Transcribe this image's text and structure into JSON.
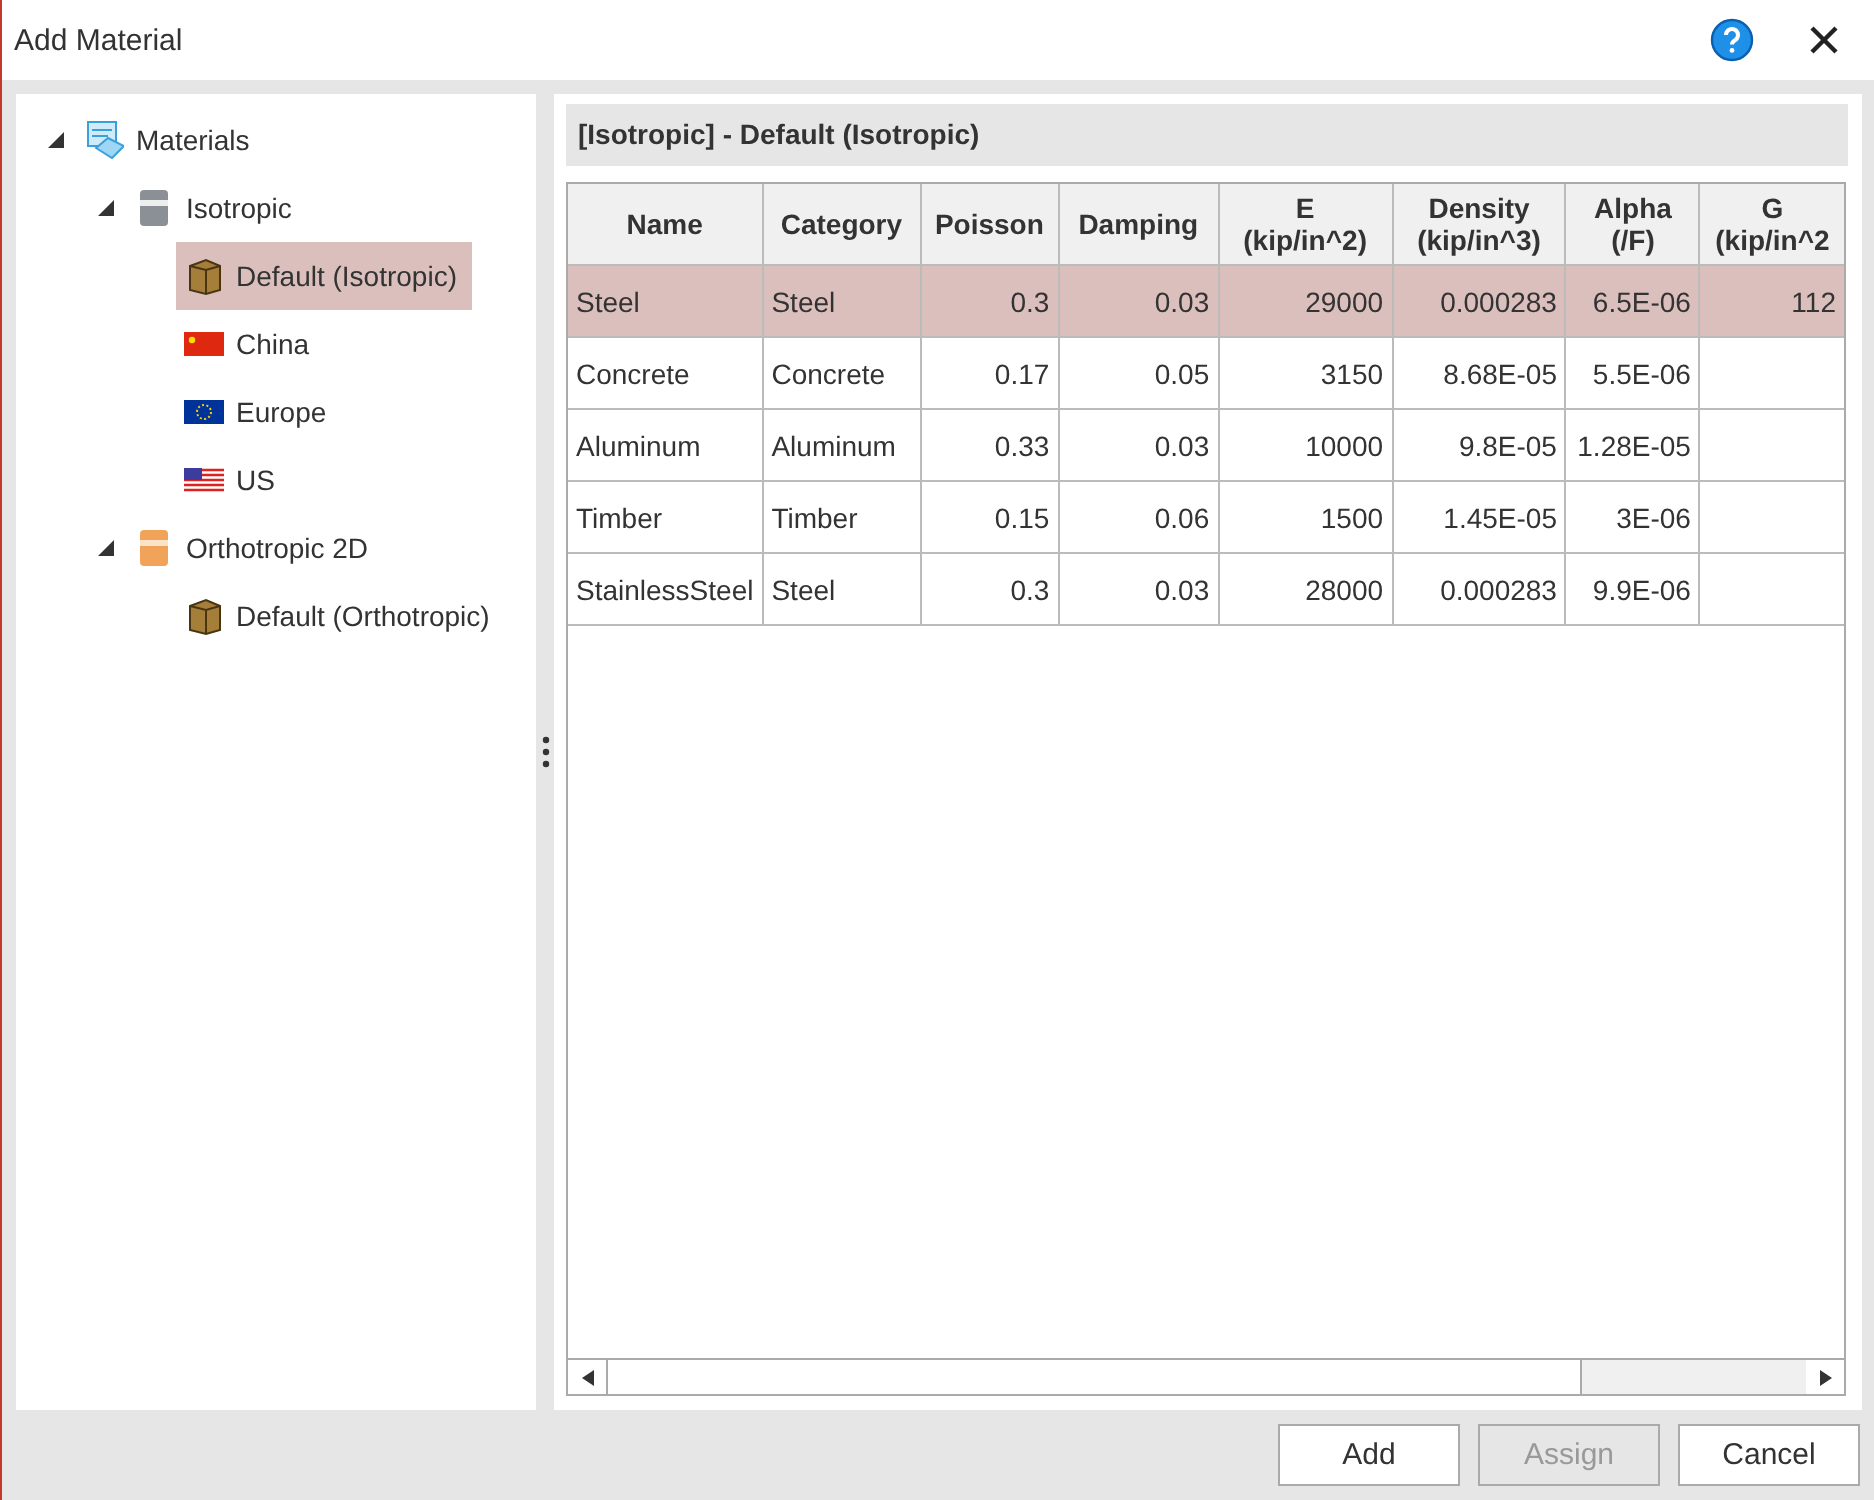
{
  "window": {
    "title": "Add Material"
  },
  "tree": [
    {
      "label": "Materials",
      "kind": "root",
      "expanded": true,
      "selected": false,
      "children": [
        {
          "label": "Isotropic",
          "kind": "group",
          "expanded": true,
          "selected": false,
          "children": [
            {
              "label": "Default (Isotropic)",
              "kind": "material",
              "selected": true
            },
            {
              "label": "China",
              "kind": "flag",
              "selected": false
            },
            {
              "label": "Europe",
              "kind": "flag",
              "selected": false
            },
            {
              "label": "US",
              "kind": "flag",
              "selected": false
            }
          ]
        },
        {
          "label": "Orthotropic 2D",
          "kind": "group",
          "expanded": true,
          "selected": false,
          "children": [
            {
              "label": "Default (Orthotropic)",
              "kind": "material",
              "selected": false
            }
          ]
        }
      ]
    }
  ],
  "panel_title": "[Isotropic] - Default (Isotropic)",
  "table": {
    "columns": [
      "Name",
      "Category",
      "Poisson",
      "Damping",
      "E\n(kip/in^2)",
      "Density\n(kip/in^3)",
      "Alpha\n(/F)",
      "G\n(kip/in^2"
    ],
    "rows": [
      {
        "selected": true,
        "cells": [
          "Steel",
          "Steel",
          "0.3",
          "0.03",
          "29000",
          "0.000283",
          "6.5E-06",
          "112"
        ]
      },
      {
        "selected": false,
        "cells": [
          "Concrete",
          "Concrete",
          "0.17",
          "0.05",
          "3150",
          "8.68E-05",
          "5.5E-06"
        ]
      },
      {
        "selected": false,
        "cells": [
          "Aluminum",
          "Aluminum",
          "0.33",
          "0.03",
          "10000",
          "9.8E-05",
          "1.28E-05"
        ]
      },
      {
        "selected": false,
        "cells": [
          "Timber",
          "Timber",
          "0.15",
          "0.06",
          "1500",
          "1.45E-05",
          "3E-06"
        ]
      },
      {
        "selected": false,
        "cells": [
          "StainlessSteel",
          "Steel",
          "0.3",
          "0.03",
          "28000",
          "0.000283",
          "9.9E-06"
        ]
      }
    ]
  },
  "buttons": [
    {
      "label": "Add",
      "disabled": false
    },
    {
      "label": "Assign",
      "disabled": true
    },
    {
      "label": "Cancel",
      "disabled": false
    }
  ]
}
